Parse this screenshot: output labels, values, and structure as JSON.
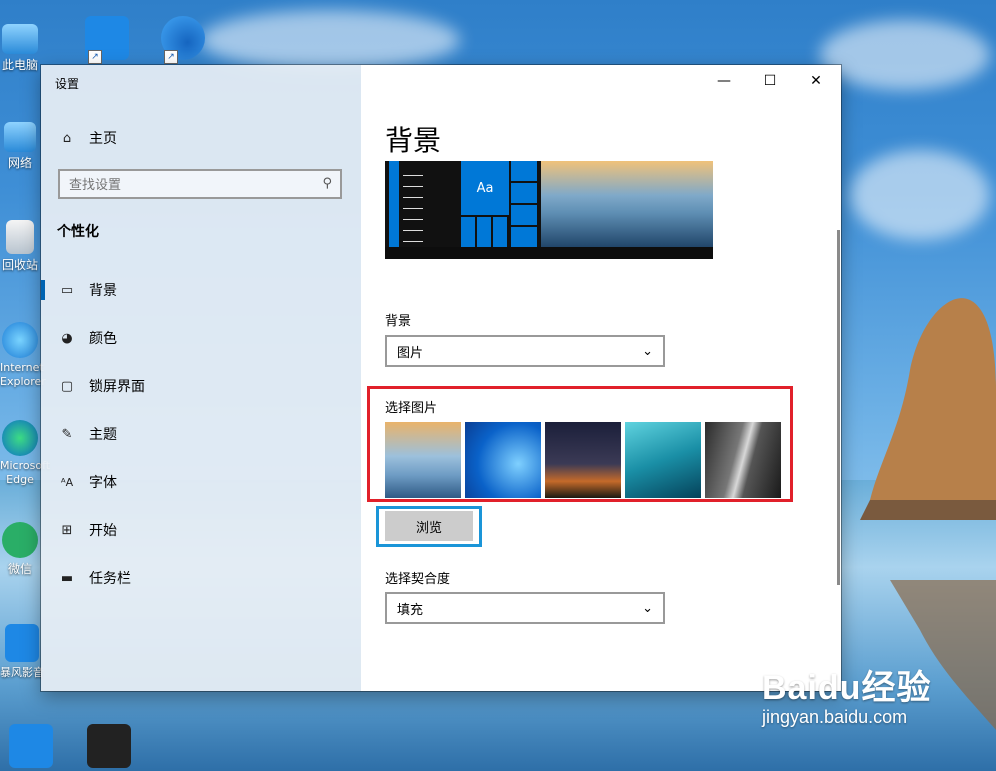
{
  "desktop": {
    "icons": [
      {
        "label": "此电脑"
      },
      {
        "label": "网络"
      },
      {
        "label": "回收站"
      },
      {
        "label": "Internet Explorer"
      },
      {
        "label": "Microsoft Edge"
      },
      {
        "label": "微信"
      },
      {
        "label": "暴风影音"
      }
    ]
  },
  "window": {
    "title": "设置",
    "caption": {
      "minimize": "—",
      "maximize": "☐",
      "close": "✕"
    }
  },
  "sidebar": {
    "home_label": "主页",
    "search_placeholder": "查找设置",
    "section": "个性化",
    "items": [
      {
        "label": "背景",
        "icon": "image-icon"
      },
      {
        "label": "颜色",
        "icon": "palette-icon"
      },
      {
        "label": "锁屏界面",
        "icon": "lock-screen-icon"
      },
      {
        "label": "主题",
        "icon": "theme-icon"
      },
      {
        "label": "字体",
        "icon": "font-icon"
      },
      {
        "label": "开始",
        "icon": "start-icon"
      },
      {
        "label": "任务栏",
        "icon": "taskbar-icon"
      }
    ]
  },
  "main": {
    "title": "背景",
    "preview_tile_text": "Aa",
    "background_label": "背景",
    "background_value": "图片",
    "choose_picture_label": "选择图片",
    "browse_label": "浏览",
    "fit_label": "选择契合度",
    "fit_value": "填充"
  },
  "watermark": {
    "brand": "Baidu经验",
    "url": "jingyan.baidu.com"
  },
  "colors": {
    "accent": "#0078d7",
    "highlight_red": "#e1202a",
    "highlight_blue": "#1a95d8"
  }
}
